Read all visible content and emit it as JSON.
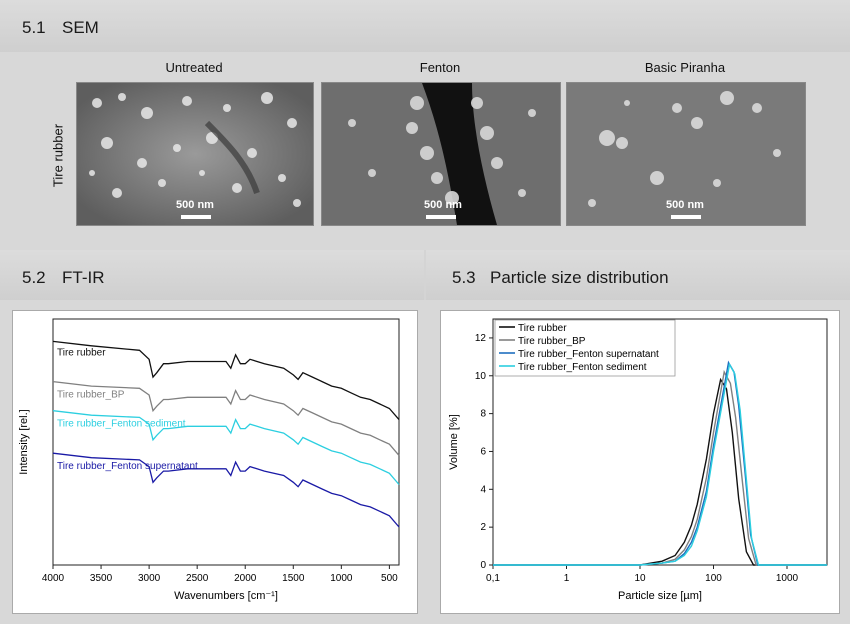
{
  "sections": {
    "sem": {
      "number": "5.1",
      "title": "SEM"
    },
    "ftir": {
      "number": "5.2",
      "title": "FT-IR"
    },
    "psd": {
      "number": "5.3",
      "title": "Particle size distribution"
    }
  },
  "sem": {
    "row_label": "Tire rubber",
    "columns": [
      "Untreated",
      "Fenton",
      "Basic Piranha"
    ],
    "scalebar": "500 nm"
  },
  "chart_data": [
    {
      "type": "line",
      "xlabel": "Wavenumbers [cm⁻¹]",
      "ylabel": "Intensity [rel.]",
      "xlim": [
        4000,
        400
      ],
      "x_ticks": [
        4000,
        3500,
        3000,
        2500,
        2000,
        1500,
        1000,
        500
      ],
      "series": [
        {
          "name": "Tire rubber",
          "color": "#111111",
          "x": [
            4000,
            3600,
            3100,
            3000,
            2960,
            2920,
            2850,
            2800,
            2600,
            2400,
            2200,
            2150,
            2100,
            2050,
            2000,
            1950,
            1800,
            1600,
            1500,
            1450,
            1400,
            1300,
            1200,
            1100,
            1000,
            900,
            800,
            700,
            600,
            500,
            400
          ],
          "y": [
            100,
            98,
            96,
            92,
            84,
            86,
            90,
            90,
            91,
            91,
            91,
            88,
            94,
            90,
            90,
            92,
            90,
            88,
            85,
            83,
            86,
            84,
            82,
            80,
            79,
            77,
            75,
            74,
            72,
            70,
            65
          ]
        },
        {
          "name": "Tire rubber_BP",
          "color": "#808080",
          "x": [
            4000,
            3600,
            3100,
            3000,
            2960,
            2920,
            2850,
            2800,
            2600,
            2400,
            2200,
            2150,
            2100,
            2050,
            2000,
            1950,
            1800,
            1600,
            1500,
            1450,
            1400,
            1300,
            1200,
            1100,
            1000,
            900,
            800,
            700,
            600,
            500,
            400
          ],
          "y": [
            82,
            80,
            79,
            76,
            69,
            71,
            74,
            74,
            75,
            75,
            75,
            72,
            78,
            74,
            74,
            76,
            74,
            72,
            69,
            67,
            70,
            68,
            66,
            64,
            63,
            61,
            59,
            58,
            56,
            54,
            49
          ]
        },
        {
          "name": "Tire rubber_Fenton sediment",
          "color": "#2ccfe0",
          "x": [
            4000,
            3600,
            3100,
            3000,
            2960,
            2920,
            2850,
            2800,
            2600,
            2400,
            2200,
            2150,
            2100,
            2050,
            2000,
            1950,
            1800,
            1600,
            1500,
            1450,
            1400,
            1300,
            1200,
            1100,
            1000,
            900,
            800,
            700,
            600,
            500,
            400
          ],
          "y": [
            69,
            67,
            66,
            63,
            56,
            58,
            61,
            61,
            62,
            62,
            62,
            59,
            65,
            61,
            61,
            63,
            61,
            59,
            56,
            54,
            57,
            55,
            53,
            51,
            50,
            48,
            46,
            45,
            43,
            41,
            36
          ]
        },
        {
          "name": "Tire rubber_Fenton supernatant",
          "color": "#1a1aa6",
          "x": [
            4000,
            3600,
            3100,
            3000,
            2960,
            2920,
            2850,
            2800,
            2600,
            2400,
            2200,
            2150,
            2100,
            2050,
            2000,
            1950,
            1800,
            1600,
            1500,
            1450,
            1400,
            1300,
            1200,
            1100,
            1000,
            900,
            800,
            700,
            600,
            500,
            400
          ],
          "y": [
            50,
            48,
            47,
            44,
            37,
            39,
            42,
            42,
            43,
            43,
            43,
            40,
            46,
            42,
            42,
            44,
            42,
            40,
            37,
            35,
            38,
            36,
            34,
            32,
            31,
            29,
            27,
            26,
            24,
            22,
            17
          ]
        }
      ]
    },
    {
      "type": "line",
      "xlabel": "Particle size [µm]",
      "ylabel": "Volume [%]",
      "xscale": "log",
      "xlim": [
        0.1,
        3500
      ],
      "ylim": [
        0,
        13
      ],
      "x_ticks": [
        "0,1",
        "1",
        "10",
        "100",
        "1000"
      ],
      "y_ticks": [
        0,
        2,
        4,
        6,
        8,
        10,
        12
      ],
      "series": [
        {
          "name": "Tire rubber",
          "color": "#111111",
          "peak_x": 125,
          "peak_y": 9.8,
          "x": [
            0.1,
            10,
            20,
            30,
            40,
            50,
            60,
            80,
            100,
            125,
            150,
            180,
            220,
            280,
            350,
            3500
          ],
          "y": [
            0,
            0,
            0.2,
            0.5,
            1.2,
            2.1,
            3.2,
            5.6,
            8.0,
            9.8,
            9.3,
            7.0,
            3.5,
            0.7,
            0,
            0
          ]
        },
        {
          "name": "Tire rubber_BP",
          "color": "#808080",
          "peak_x": 140,
          "peak_y": 10.2,
          "x": [
            0.1,
            10,
            20,
            30,
            40,
            50,
            60,
            80,
            100,
            140,
            170,
            200,
            250,
            300,
            380,
            3500
          ],
          "y": [
            0,
            0,
            0.1,
            0.3,
            0.8,
            1.5,
            2.4,
            4.6,
            7.0,
            10.2,
            9.6,
            7.8,
            4.2,
            1.4,
            0,
            0
          ]
        },
        {
          "name": "Tire rubber_Fenton supernatant",
          "color": "#1f6fc0",
          "peak_x": 160,
          "peak_y": 10.7,
          "x": [
            0.1,
            10,
            20,
            30,
            40,
            50,
            60,
            80,
            100,
            160,
            190,
            220,
            270,
            320,
            400,
            3500
          ],
          "y": [
            0,
            0,
            0.1,
            0.2,
            0.6,
            1.2,
            2.0,
            3.9,
            6.3,
            10.7,
            10.2,
            8.4,
            4.8,
            1.6,
            0,
            0
          ]
        },
        {
          "name": "Tire rubber_Fenton sediment",
          "color": "#2ccfe0",
          "peak_x": 165,
          "peak_y": 10.6,
          "x": [
            0.1,
            10,
            20,
            30,
            40,
            50,
            60,
            80,
            100,
            165,
            195,
            230,
            280,
            330,
            410,
            3500
          ],
          "y": [
            0,
            0,
            0.1,
            0.2,
            0.5,
            1.0,
            1.8,
            3.6,
            6.0,
            10.6,
            10.1,
            8.2,
            4.5,
            1.4,
            0,
            0
          ]
        }
      ]
    }
  ]
}
